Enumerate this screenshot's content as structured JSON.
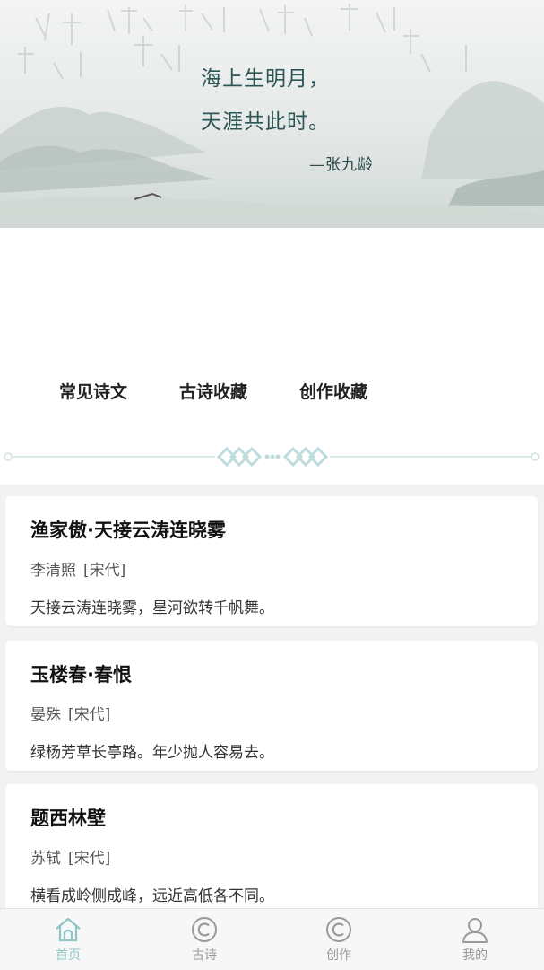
{
  "banner": {
    "line1": "海上生明月，",
    "line2": "天涯共此时。",
    "author": "—张九龄"
  },
  "shortcuts": [
    {
      "label": "常见诗文"
    },
    {
      "label": "古诗收藏"
    },
    {
      "label": "创作收藏"
    }
  ],
  "poems": [
    {
      "title": "渔家傲·天接云涛连晓雾",
      "author": "李清照",
      "dynasty": "[宋代]",
      "line": "天接云涛连晓雾，星河欲转千帆舞。"
    },
    {
      "title": "玉楼春·春恨",
      "author": "晏殊",
      "dynasty": "[宋代]",
      "line": "绿杨芳草长亭路。年少抛人容易去。"
    },
    {
      "title": "题西林壁",
      "author": "苏轼",
      "dynasty": "[宋代]",
      "line": "横看成岭侧成峰，远近高低各不同。"
    }
  ],
  "tabbar": [
    {
      "label": "首页",
      "icon": "home-icon",
      "active": true
    },
    {
      "label": "古诗",
      "icon": "copyright-icon",
      "active": false
    },
    {
      "label": "创作",
      "icon": "copyright-icon",
      "active": false
    },
    {
      "label": "我的",
      "icon": "user-icon",
      "active": false
    }
  ],
  "colors": {
    "accent": "#8fc5c5",
    "quote": "#2b5656",
    "tab_inactive": "#9a9a9a"
  }
}
